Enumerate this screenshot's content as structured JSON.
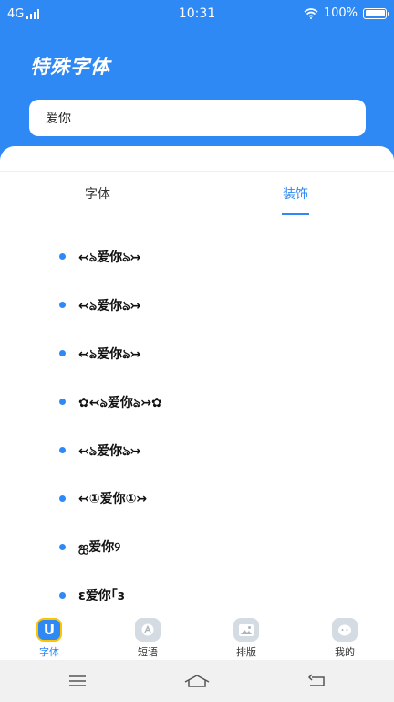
{
  "status_bar": {
    "network": "4G",
    "time": "10:31",
    "battery": "100%"
  },
  "header": {
    "title": "特殊字体"
  },
  "search": {
    "value": "爱你"
  },
  "tabs": [
    {
      "label": "字体",
      "active": false
    },
    {
      "label": "装饰",
      "active": true
    }
  ],
  "decorations": [
    "↢ঌ爱你ঌ↣",
    "↢ঌ爱你ঌ↣",
    "↢ঌ爱你ঌ↣",
    "✿↢ঌ爱你ঌ↣✿",
    "↢ঌ爱你ঌ↣",
    "↢①爱你①↣",
    "ஐ爱你୨",
    "ε爱你｢з"
  ],
  "bottom_nav": [
    {
      "label": "字体",
      "icon": "font-u-icon",
      "active": true
    },
    {
      "label": "短语",
      "icon": "phrase-icon",
      "active": false
    },
    {
      "label": "排版",
      "icon": "image-icon",
      "active": false
    },
    {
      "label": "我的",
      "icon": "profile-icon",
      "active": false
    }
  ],
  "colors": {
    "primary": "#2f89f5",
    "accent_yellow": "#ffc400",
    "text": "#111111",
    "nav_icon_grey": "#d4dbe2"
  }
}
